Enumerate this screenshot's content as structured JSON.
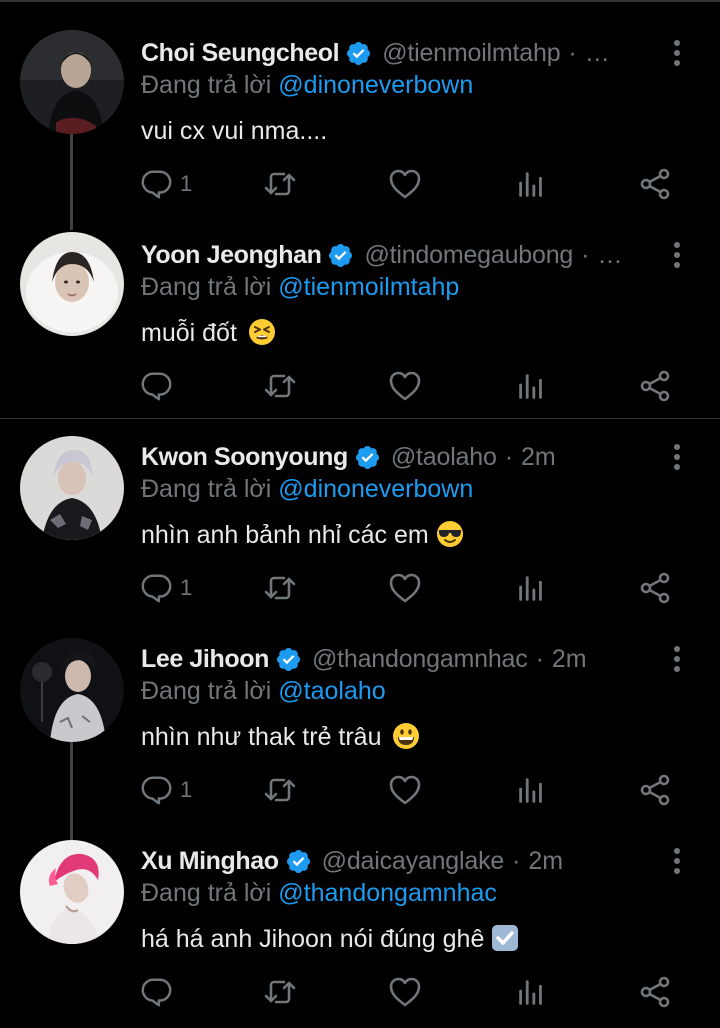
{
  "replying_prefix": "Đang trả lời",
  "tweets": [
    {
      "name": "Choi Seungcheol",
      "handle": "@tienmoilmtahp",
      "time": "",
      "time_sep": "·",
      "ellipsis": "…",
      "reply_to": "@dinoneverbown",
      "text": "vui cx vui nma....",
      "emoji": "",
      "reply_count": "1",
      "avatar": "avatar-choi-seungcheol"
    },
    {
      "name": "Yoon Jeonghan",
      "handle": "@tindomegaubong",
      "time": "",
      "time_sep": "·",
      "ellipsis": "…",
      "reply_to": "@tienmoilmtahp",
      "text": "muỗi đốt",
      "emoji": "tired-face-emoji",
      "reply_count": "",
      "avatar": "avatar-yoon-jeonghan"
    },
    {
      "name": "Kwon Soonyoung",
      "handle": "@taolaho",
      "time": "2m",
      "time_sep": "·",
      "ellipsis": "",
      "reply_to": "@dinoneverbown",
      "text": "nhìn anh bảnh nhỉ các em",
      "emoji": "sunglasses-face-emoji",
      "reply_count": "1",
      "avatar": "avatar-kwon-soonyoung"
    },
    {
      "name": "Lee Jihoon",
      "handle": "@thandongamnhac",
      "time": "2m",
      "time_sep": "·",
      "ellipsis": "",
      "reply_to": "@taolaho",
      "text": "nhìn như thak trẻ trâu",
      "emoji": "grinning-face-emoji",
      "reply_count": "1",
      "avatar": "avatar-lee-jihoon"
    },
    {
      "name": "Xu Minghao",
      "handle": "@daicayanglake",
      "time": "2m",
      "time_sep": "·",
      "ellipsis": "",
      "reply_to": "@thandongamnhac",
      "text": "há há anh Jihoon nói đúng ghê",
      "emoji": "check-mark-button-emoji",
      "reply_count": "",
      "avatar": "avatar-xu-minghao"
    }
  ],
  "colors": {
    "background": "#000000",
    "text": "#e7e9ea",
    "secondary": "#71767b",
    "accent": "#1d9bf0",
    "divider": "#2f3336",
    "thread_line": "#3e4144"
  },
  "icons": [
    "verified-badge-icon",
    "more-options-icon",
    "reply-icon",
    "retweet-icon",
    "like-icon",
    "views-icon",
    "share-icon"
  ]
}
